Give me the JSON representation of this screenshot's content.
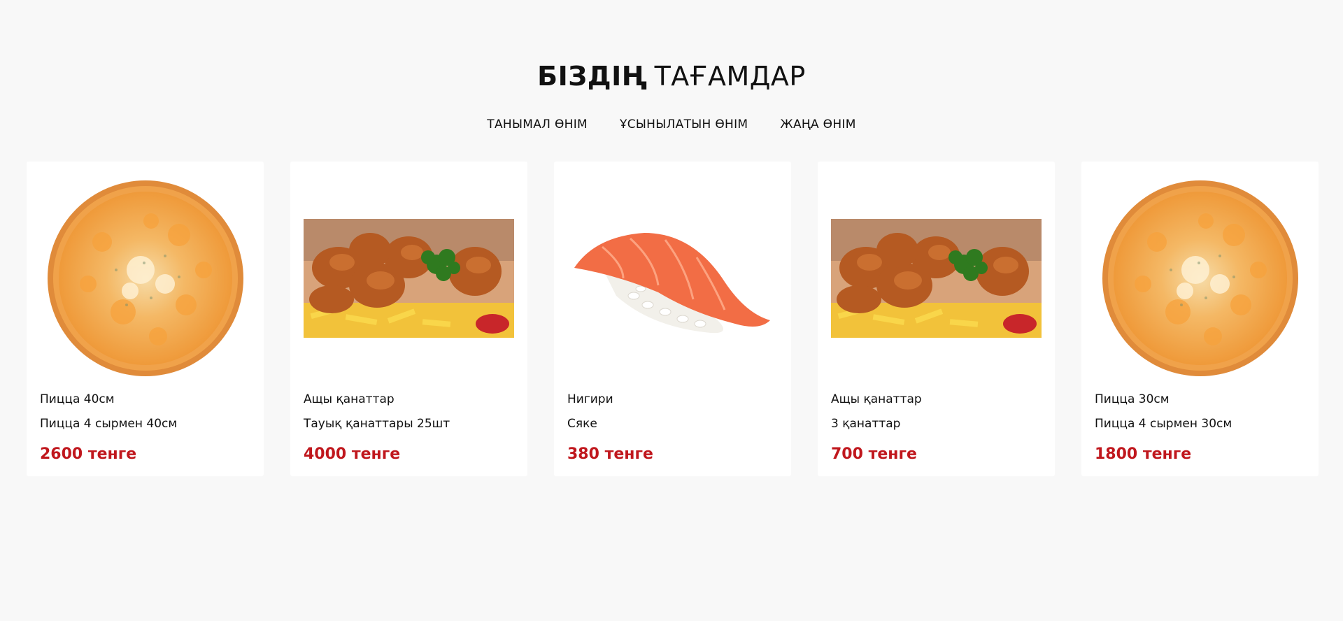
{
  "header": {
    "title_bold": "БІЗДІҢ",
    "title_light": "ТАҒАМДАР"
  },
  "tabs": [
    {
      "label": "ТАНЫМАЛ ӨНІМ"
    },
    {
      "label": "ҰСЫНЫЛАТЫН ӨНІМ"
    },
    {
      "label": "ЖАҢА ӨНІМ"
    }
  ],
  "products": [
    {
      "name": "Пицца 40см",
      "description": "Пицца 4 сырмен 40см",
      "price": "2600 тенге",
      "image_icon": "pizza-image"
    },
    {
      "name": "Ащы қанаттар",
      "description": "Тауық қанаттары 25шт",
      "price": "4000 тенге",
      "image_icon": "chicken-wings-image"
    },
    {
      "name": "Нигири",
      "description": "Сяке",
      "price": "380 тенге",
      "image_icon": "nigiri-sushi-image"
    },
    {
      "name": "Ащы қанаттар",
      "description": "3 қанаттар",
      "price": "700 тенге",
      "image_icon": "chicken-wings-image"
    },
    {
      "name": "Пицца 30см",
      "description": "Пицца 4 сырмен 30см",
      "price": "1800 тенге",
      "image_icon": "pizza-image"
    }
  ],
  "colors": {
    "price": "#c0171d",
    "background": "#f8f8f8",
    "card": "#ffffff"
  }
}
